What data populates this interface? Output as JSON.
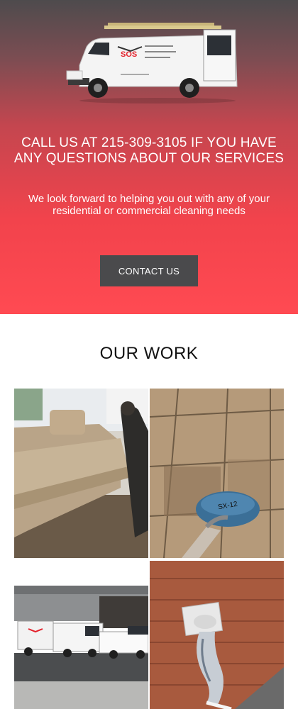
{
  "hero": {
    "title": "CALL US AT 215-309-3105 IF YOU HAVE ANY QUESTIONS ABOUT OUR SERVICES",
    "subtitle": "We look forward to helping you out with any of your residential or commercial cleaning needs",
    "contact_button": "CONTACT US",
    "van_logo_text": "SOS"
  },
  "our_work": {
    "title": "OUR WORK",
    "images": [
      {
        "icon": "sofa-cleaning-photo"
      },
      {
        "icon": "tile-floor-cleaning-photo"
      },
      {
        "icon": "service-vans-fleet-photo"
      },
      {
        "icon": "dryer-vent-cleaning-photo"
      }
    ]
  },
  "colors": {
    "hero_top": "#4e4b4d",
    "hero_bottom": "#ff4a52",
    "button_bg": "#4a4a4c",
    "brand_red": "#e4222c"
  }
}
